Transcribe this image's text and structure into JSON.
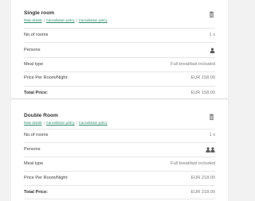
{
  "rooms": [
    {
      "name": "Single room",
      "links": [
        "Rate details",
        "Cancellation policy",
        "Cancellation policy"
      ],
      "rows": {
        "rooms_label": "No.of rooms",
        "rooms_value": "1 x",
        "persons_label": "Persons",
        "persons_icon": "person-icon",
        "meal_label": "Meal type",
        "meal_value": "Full breakfast included",
        "price_label": "Price Per Room/Night:",
        "price_value": "EUR 158.00",
        "total_label": "Total Price:",
        "total_value": "EUR 158.00"
      }
    },
    {
      "name": "Double Room",
      "links": [
        "Rate details",
        "Cancellation policy",
        "Cancellation policy"
      ],
      "rows": {
        "rooms_label": "No.of rooms",
        "rooms_value": "1 x",
        "persons_label": "Persons",
        "persons_icon": "two-persons-icon",
        "meal_label": "Meal type",
        "meal_value": "Full breakfast included",
        "price_label": "Price Per Room/Night:",
        "price_value": "EUR 218.00",
        "total_label": "Total Price:",
        "total_value": "EUR 218.00"
      }
    }
  ],
  "colors": {
    "link": "#2e8b6d",
    "text": "#3d3d3d",
    "muted": "#7a7a7a",
    "background": "#f2f2f2",
    "card": "#ffffff"
  }
}
